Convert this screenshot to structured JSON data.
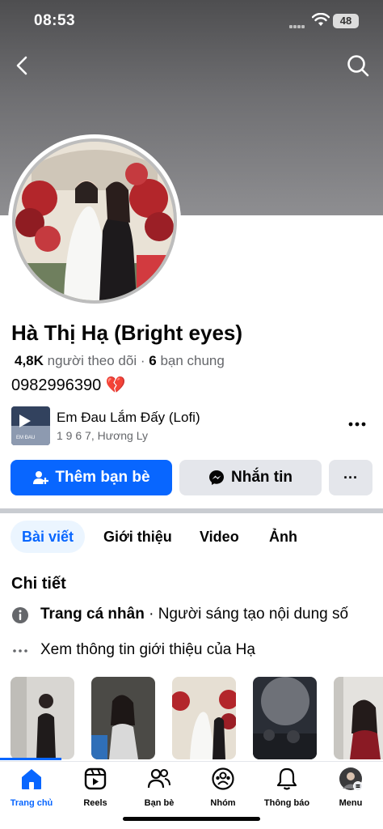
{
  "status_bar": {
    "time": "08:53",
    "battery": "48"
  },
  "profile": {
    "name": "Hà Thị Hạ (Bright eyes)",
    "followers_count": "4,8K",
    "followers_label": "người theo dõi",
    "separator": "·",
    "mutual_count": "6",
    "mutual_label": "bạn chung",
    "bio": "0982996390 💔"
  },
  "music": {
    "title": "Em Đau Lắm Đấy (Lofi)",
    "artist": "1 9 6 7, Hương Ly",
    "thumb_text": "EM ĐAU"
  },
  "actions": {
    "add_friend": "Thêm bạn bè",
    "message": "Nhắn tin",
    "more": "···"
  },
  "tabs": [
    {
      "label": "Bài viết",
      "active": true
    },
    {
      "label": "Giới thiệu",
      "active": false
    },
    {
      "label": "Video",
      "active": false
    },
    {
      "label": "Ảnh",
      "active": false
    }
  ],
  "details": {
    "title": "Chi tiết",
    "profile_type_bold": "Trang cá nhân",
    "profile_type_rest": " · Người sáng tạo nội dung số",
    "see_about": "Xem thông tin giới thiệu của Hạ"
  },
  "bottom_nav": [
    {
      "label": "Trang chủ",
      "icon": "home-icon",
      "active": true
    },
    {
      "label": "Reels",
      "icon": "reels-icon",
      "active": false
    },
    {
      "label": "Bạn bè",
      "icon": "friends-icon",
      "active": false
    },
    {
      "label": "Nhóm",
      "icon": "groups-icon",
      "active": false
    },
    {
      "label": "Thông báo",
      "icon": "bell-icon",
      "active": false
    },
    {
      "label": "Menu",
      "icon": "menu-avatar-icon",
      "active": false
    }
  ],
  "colors": {
    "primary": "#0866ff",
    "secondary_bg": "#e4e6eb",
    "muted_text": "#65676b"
  }
}
